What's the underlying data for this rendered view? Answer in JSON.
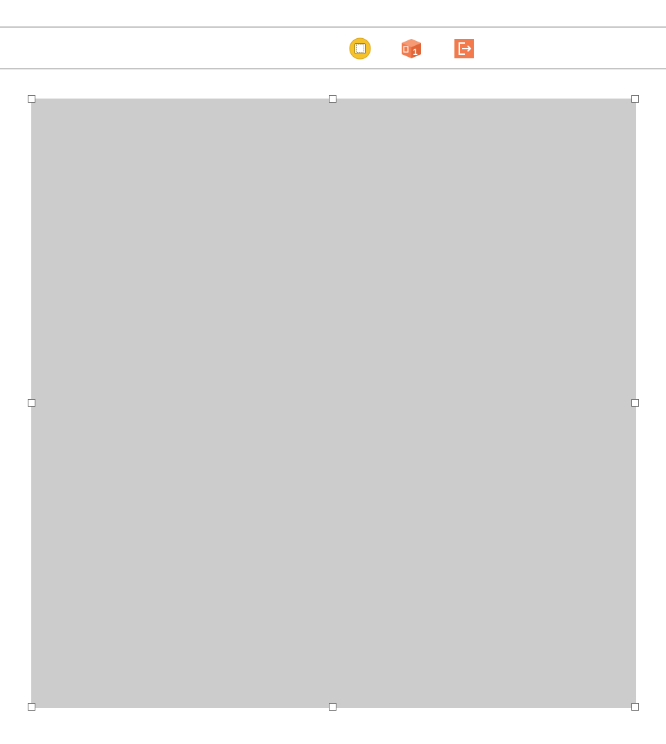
{
  "scene_dock": {
    "items": [
      {
        "icon": "view-controller-icon",
        "color": "#F5C22C"
      },
      {
        "icon": "first-responder-icon",
        "color": "#F27A4C"
      },
      {
        "icon": "exit-icon",
        "color": "#F27A4C"
      }
    ]
  },
  "canvas": {
    "background_color": "#CCCCCC",
    "selected": true
  }
}
